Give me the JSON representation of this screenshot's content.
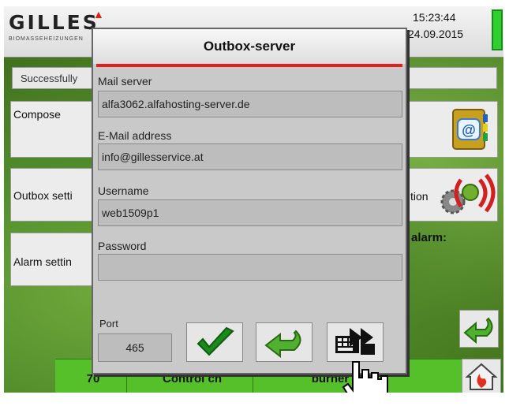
{
  "header": {
    "logo_text": "GILLES",
    "logo_subtitle": "BIOMASSEHEIZUNGEN",
    "time": "15:23:44",
    "date": "24.09.2015"
  },
  "main": {
    "status_text": "Successfully",
    "menu": {
      "compose_label": "Compose",
      "outbox_label": "Outbox setti",
      "alarm_label": "Alarm settin"
    },
    "right": {
      "connection_label": "tion",
      "alarm_text": "alarm:"
    },
    "bottom_bar": {
      "segment1": "70",
      "segment2": "Control cn",
      "segment3": "burner"
    }
  },
  "dialog": {
    "title": "Outbox-server",
    "mail_server_label": "Mail server",
    "mail_server_value": "alfa3062.alfahosting-server.de",
    "email_label": "E-Mail address",
    "email_value": "info@gillesservice.at",
    "username_label": "Username",
    "username_value": "web1509p1",
    "password_label": "Password",
    "password_value": "",
    "port_label": "Port",
    "port_value": "465"
  },
  "icons": {
    "confirm": "checkmark-icon",
    "back": "back-arrow-icon",
    "keyboard": "keyboard-icon",
    "addressbook": "address-book-icon",
    "connection": "connection-gear-icon",
    "home": "home-flame-icon",
    "cursor": "hand-pointer-icon"
  },
  "colors": {
    "accent_red": "#e02020",
    "bottom_bar_green": "#55c02a",
    "check_green": "#1a8a1a"
  }
}
